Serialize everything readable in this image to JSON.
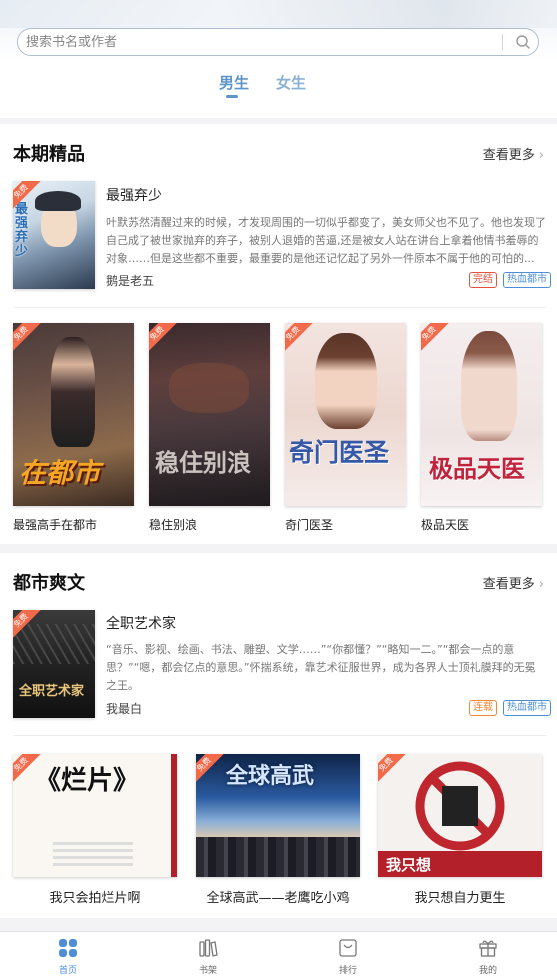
{
  "search": {
    "placeholder": "搜索书名或作者"
  },
  "gender_tabs": {
    "male": "男生",
    "female": "女生"
  },
  "free_label": "免费",
  "featured": {
    "title": "本期精品",
    "more": "查看更多",
    "main_book": {
      "title": "最强弃少",
      "desc": "叶默苏然清醒过来的时候，才发现周围的一切似乎都变了，美女师父也不见了。他也发现了自己成了被世家抛弃的弃子，被别人退婚的苦逼,还是被女人站在讲台上拿着他情书羞辱的对象……但是这些都不重要，最重要的是他还记忆起了另外一件原本不属于他的可怕的...",
      "author": "鹅是老五",
      "tags": [
        "完结",
        "热血都市"
      ],
      "cover_text": "最强弃少"
    },
    "grid": [
      {
        "title": "最强高手在都市",
        "cover_text": "在都市"
      },
      {
        "title": "稳住别浪",
        "cover_text": "稳住别浪"
      },
      {
        "title": "奇门医圣",
        "cover_text": "奇门医圣"
      },
      {
        "title": "极品天医",
        "cover_text": "极品天医"
      }
    ]
  },
  "urban": {
    "title": "都市爽文",
    "more": "查看更多",
    "main_book": {
      "title": "全职艺术家",
      "desc": "“音乐、影视、绘画、书法、雕塑、文学……”“你都懂？”“略知一二。”“都会一点的意思？”“嗯，都会亿点的意思。”怀揣系统，靠艺术征服世界，成为各界人士顶礼膜拜的无冕之王。",
      "author": "我最白",
      "tags": [
        "连载",
        "热血都市"
      ],
      "cover_text": "全职艺术家"
    },
    "grid": [
      {
        "title": "我只会拍烂片啊",
        "cover_text": "《烂片》"
      },
      {
        "title": "全球高武——老鹰吃小鸡",
        "cover_text": "全球高武"
      },
      {
        "title": "我只想自力更生",
        "cover_text": "我只想"
      }
    ]
  },
  "tabbar": [
    {
      "label": "首页",
      "icon": "home-icon",
      "active": true
    },
    {
      "label": "书架",
      "icon": "bookshelf-icon",
      "active": false
    },
    {
      "label": "排行",
      "icon": "ranking-icon",
      "active": false
    },
    {
      "label": "我的",
      "icon": "gift-icon",
      "active": false
    }
  ],
  "colors": {
    "accent": "#5d95c8",
    "tag_finished": "#e5533d",
    "tag_serial": "#f0883a",
    "tag_genre": "#4d8fd6"
  }
}
